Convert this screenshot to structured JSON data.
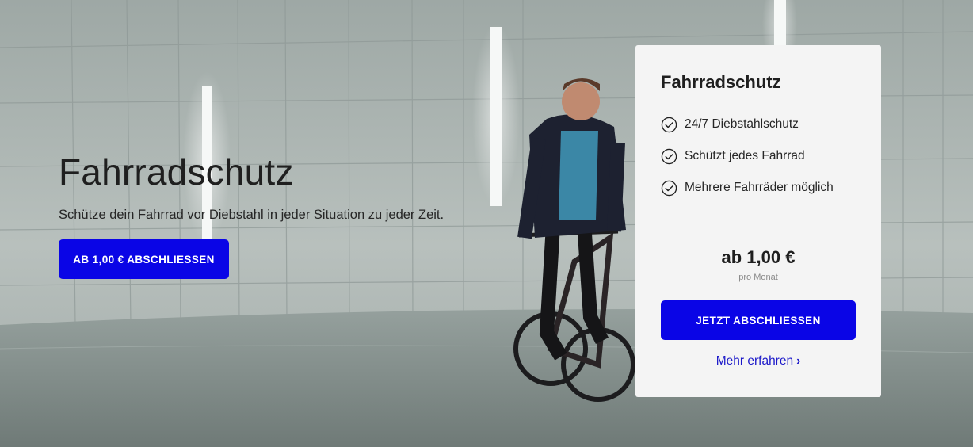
{
  "hero": {
    "title": "Fahrradschutz",
    "subtitle": "Schütze dein Fahrrad vor Diebstahl in jeder Situation zu jeder Zeit.",
    "cta_label": "AB 1,00 € ABSCHLIESSEN",
    "background_image": "cyclist-in-parking-garage"
  },
  "card": {
    "title": "Fahrradschutz",
    "features": [
      {
        "icon": "check-circle-icon",
        "label": "24/7 Diebstahlschutz"
      },
      {
        "icon": "check-circle-icon",
        "label": "Schützt jedes Fahrrad"
      },
      {
        "icon": "check-circle-icon",
        "label": "Mehrere Fahrräder möglich"
      }
    ],
    "price": "ab 1,00 €",
    "price_note": "pro Monat",
    "cta_label": "JETZT ABSCHLIESSEN",
    "more_label": "Mehr erfahren",
    "more_icon": "chevron-right-icon"
  },
  "colors": {
    "primary_button": "#0a05e6",
    "link": "#1a17c9",
    "card_background": "#f4f4f4"
  }
}
